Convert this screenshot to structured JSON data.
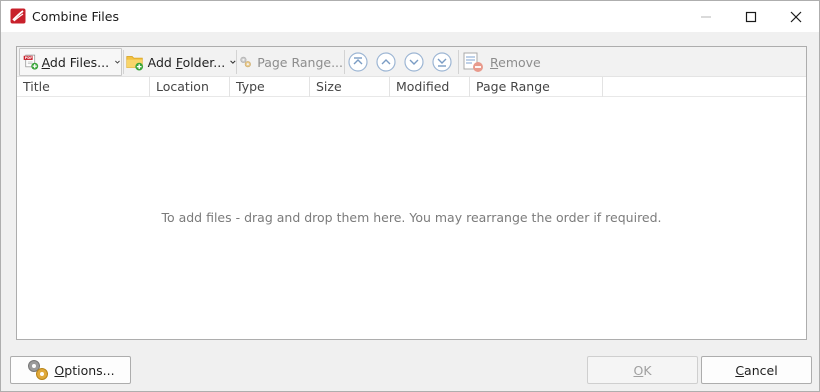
{
  "window": {
    "title": "Combine Files",
    "accent_color": "#c8202b"
  },
  "toolbar": {
    "add_files": {
      "prefix": "A",
      "label": "dd Files...",
      "icon": "pdf-add-icon"
    },
    "add_folder": {
      "prefix": "Add ",
      "label_ul": "F",
      "label": "older...",
      "icon": "folder-add-icon"
    },
    "page_range": {
      "label": "Page Range...",
      "icon": "gears-icon",
      "enabled": false
    },
    "nav": {
      "move_top_icon": "move-to-top-icon",
      "move_up_icon": "move-up-icon",
      "move_down_icon": "move-down-icon",
      "move_bottom_icon": "move-to-bottom-icon"
    },
    "remove": {
      "ul": "R",
      "label": "emove",
      "icon": "remove-file-icon",
      "enabled": false
    }
  },
  "columns": [
    "Title",
    "Location",
    "Type",
    "Size",
    "Modified",
    "Page Range"
  ],
  "empty_message": "To add files - drag and drop them here. You may rearrange the order if required.",
  "buttons": {
    "options": {
      "ul": "O",
      "label": "ptions..."
    },
    "ok": {
      "ul": "O",
      "label": "K",
      "enabled": false
    },
    "cancel": {
      "ul": "C",
      "label": "ancel"
    }
  }
}
